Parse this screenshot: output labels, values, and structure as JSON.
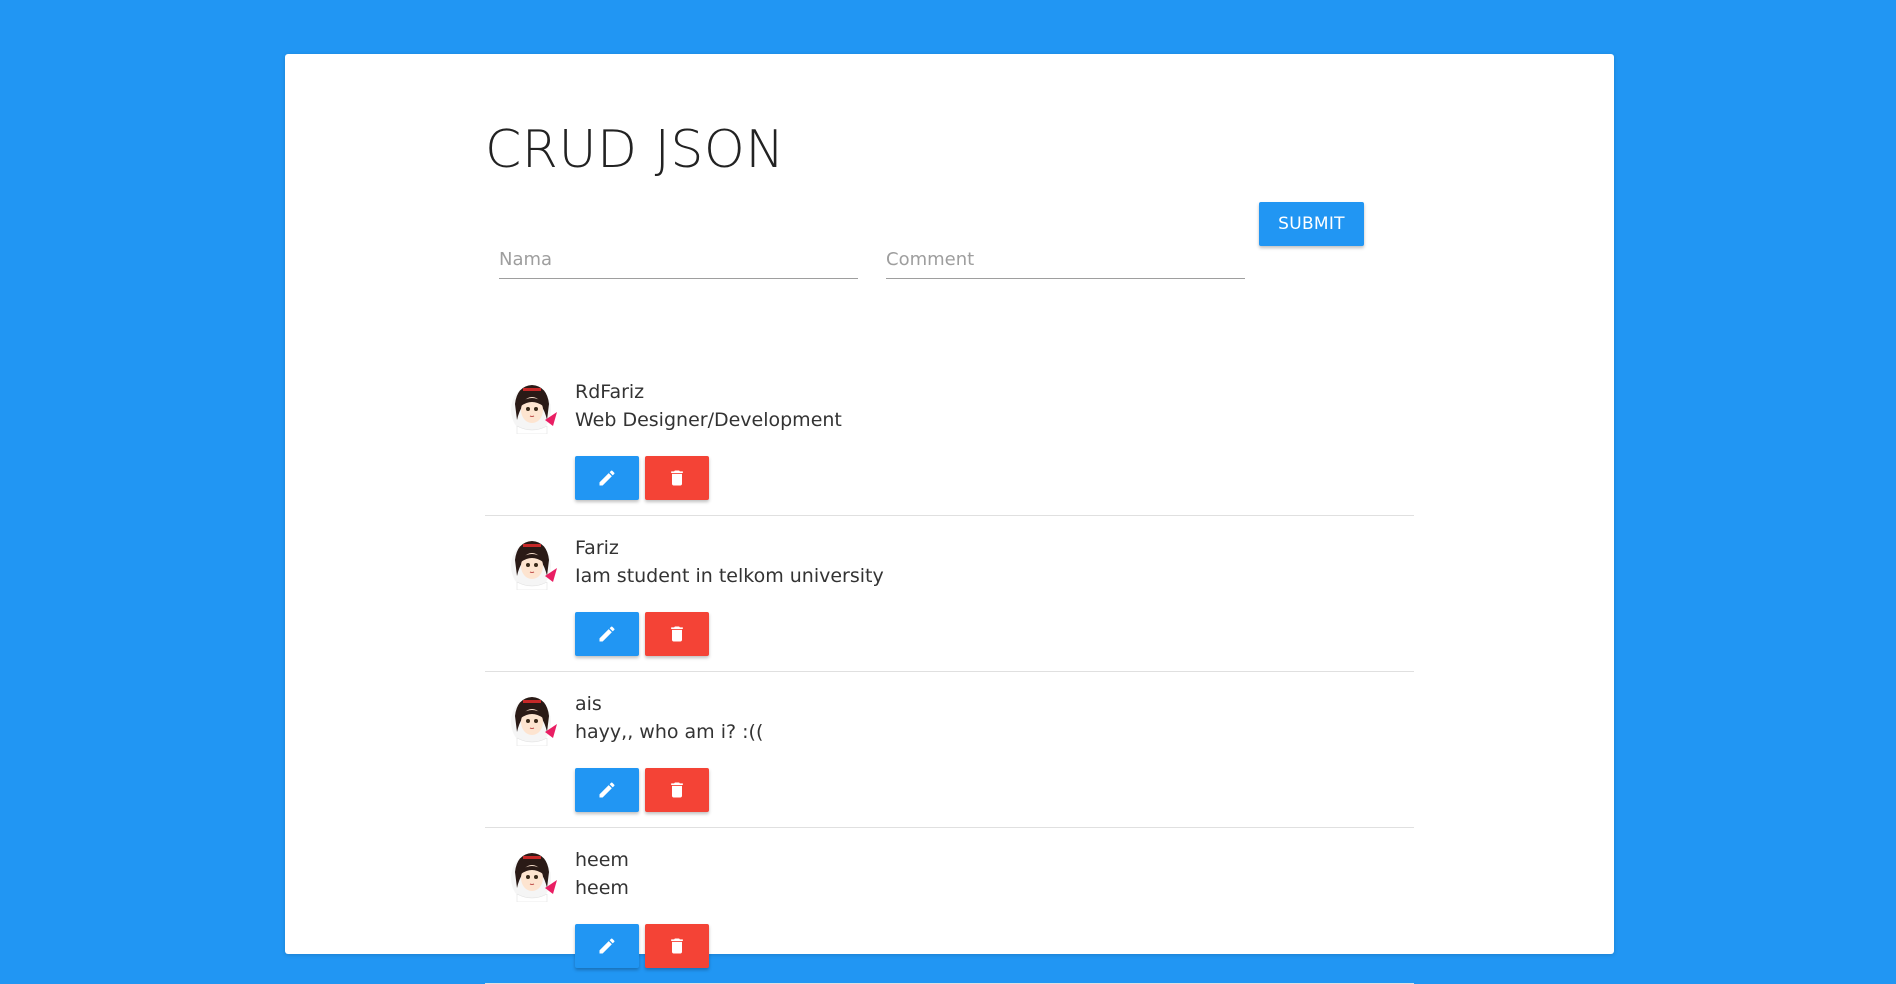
{
  "page": {
    "title": "CRUD JSON"
  },
  "form": {
    "name_placeholder": "Nama",
    "comment_placeholder": "Comment",
    "submit_label": "SUBMIT"
  },
  "colors": {
    "background": "#2196F3",
    "edit_button": "#2196F3",
    "delete_button": "#F44336"
  },
  "icons": {
    "edit": "pencil-icon",
    "delete": "trash-icon",
    "avatar": "anime-girl-avatar"
  },
  "comments": [
    {
      "name": "RdFariz",
      "comment": "Web Designer/Development"
    },
    {
      "name": "Fariz",
      "comment": "Iam student in telkom university"
    },
    {
      "name": "ais",
      "comment": "hayy,, who am i? :(("
    },
    {
      "name": "heem",
      "comment": "heem"
    }
  ]
}
